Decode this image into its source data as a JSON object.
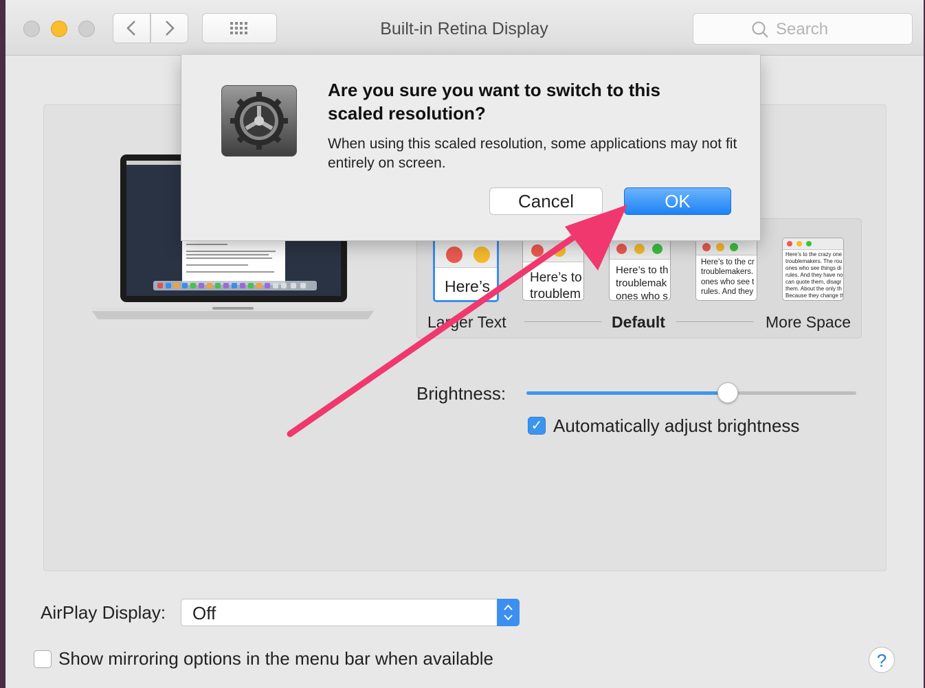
{
  "window": {
    "title": "Built-in Retina Display",
    "search_placeholder": "Search"
  },
  "display": {
    "scaled_options": [
      {
        "preview_text": "Here’s"
      },
      {
        "preview_text": "Here’s to\ntroublem"
      },
      {
        "preview_text": "Here’s to th\ntroublemak\nones who s"
      },
      {
        "preview_text": "Here’s to the cr\ntroublemakers.\nones who see t\nrules. And they"
      },
      {
        "preview_text": "Here’s to the crazy one\ntroublemakers. The rou\nones who see things di\nrules. And they have no\ncan quote them, disagr\nthem. About the only th\nBecause they change th"
      }
    ],
    "scale_labels": {
      "left": "Larger Text",
      "center": "Default",
      "right": "More Space"
    },
    "brightness_label": "Brightness:",
    "brightness_level": 0.61,
    "auto_brightness_label": "Automatically adjust brightness",
    "auto_brightness_checked": true
  },
  "airplay": {
    "label": "AirPlay Display:",
    "value": "Off"
  },
  "mirroring": {
    "label": "Show mirroring options in the menu bar when available",
    "checked": false
  },
  "help_label": "?",
  "dialog": {
    "title": "Are you sure you want to switch to this scaled resolution?",
    "message": "When using this scaled resolution, some applications may not fit entirely on screen.",
    "cancel_label": "Cancel",
    "ok_label": "OK"
  },
  "colors": {
    "accent": "#3b95ef",
    "arrow": "#f0386e",
    "close": "#cfcfcf",
    "minimize": "#fbbd2e",
    "zoom": "#cfcfcf"
  }
}
